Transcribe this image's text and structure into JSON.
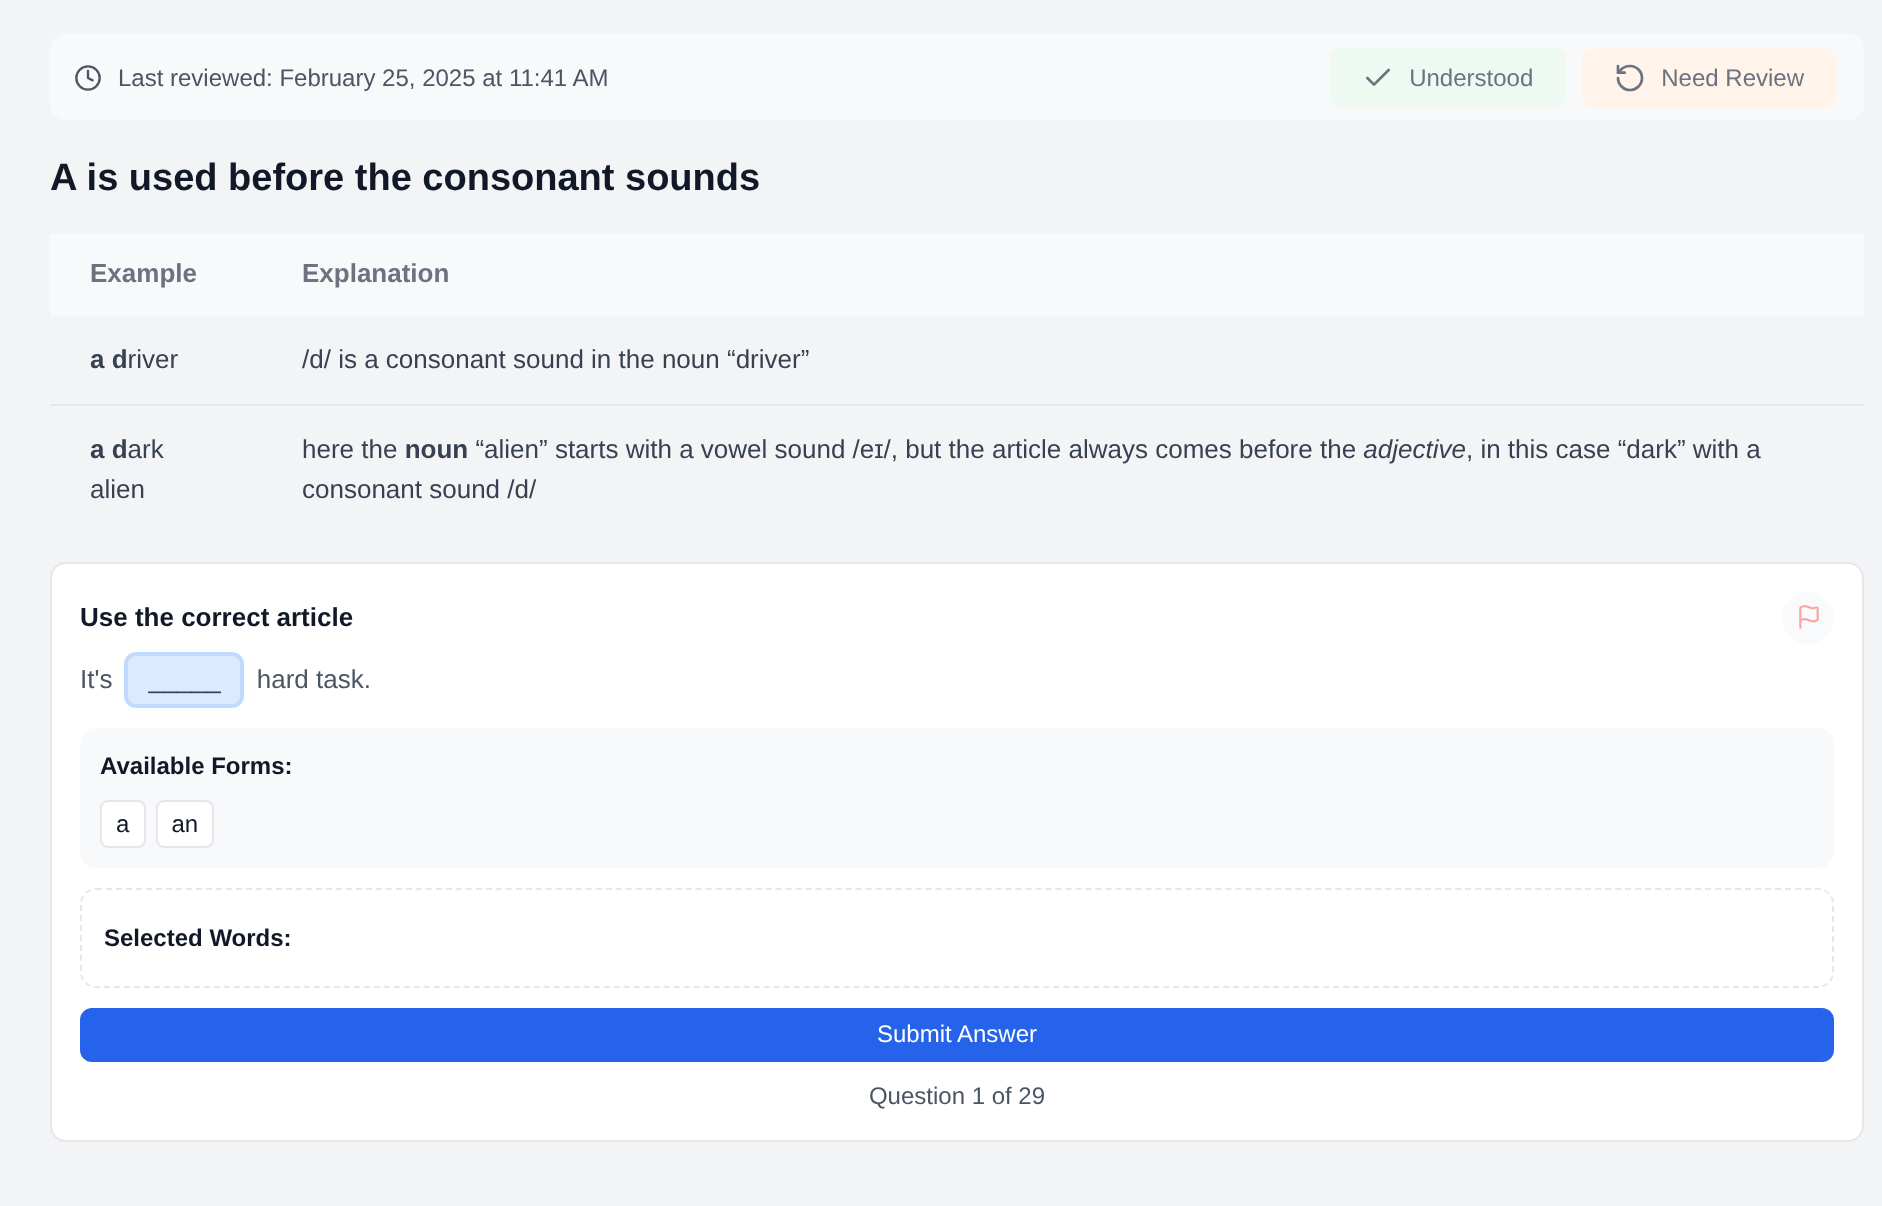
{
  "review_bar": {
    "last_reviewed": "Last reviewed: February 25, 2025 at 11:41 AM",
    "buttons": [
      {
        "kind": "understood",
        "label": "Understood"
      },
      {
        "kind": "review",
        "label": "Need Review"
      }
    ]
  },
  "title": "A is used before the consonant sounds",
  "table": {
    "columns": [
      "Example",
      "Explanation"
    ],
    "rows": [
      {
        "example": "**a d**river",
        "explanation": "/d/ is a consonant sound in the noun “driver”"
      },
      {
        "example": "**a d**ark alien",
        "explanation": "here the **noun** “alien” starts with a vowel sound /eɪ/, but the article always comes before the *adjective*, in this case “dark” with a consonant sound /d/"
      }
    ]
  },
  "exercise": {
    "title": "Use the correct article",
    "sentence_before": "It's",
    "blank": "_____",
    "sentence_after": "hard task.",
    "available_label": "Available Forms:",
    "forms": [
      "a",
      "an"
    ],
    "selected_label": "Selected Words:",
    "submit": "Submit Answer",
    "progress": "Question 1 of 29"
  }
}
